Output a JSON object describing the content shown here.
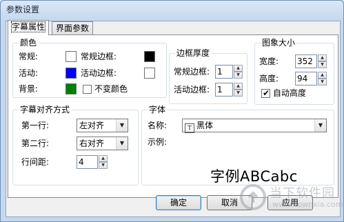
{
  "window": {
    "title": "参数设置"
  },
  "tabs": [
    {
      "label": "字幕属性",
      "active": true
    },
    {
      "label": "界面参数",
      "active": false
    }
  ],
  "colors_group": {
    "legend": "颜色",
    "normal_label": "常规:",
    "normal_color": "#ffffff",
    "normal_border_label": "常规边框:",
    "normal_border_color": "#000000",
    "active_label": "活动:",
    "active_color": "#0000ff",
    "active_border_label": "活动边框:",
    "active_border_color": "#ffffff",
    "background_label": "背景:",
    "background_color": "#008000",
    "fixed_color_label": "不变颜色",
    "fixed_color_checked": false
  },
  "border_thickness_group": {
    "legend": "边框厚度",
    "normal_label": "常规边框:",
    "normal_value": "1",
    "active_label": "活动边框:",
    "active_value": "1"
  },
  "image_size_group": {
    "legend": "图象大小",
    "width_label": "宽度:",
    "width_value": "352",
    "height_label": "高度:",
    "height_value": "94",
    "auto_height_label": "自动高度",
    "auto_height_checked": true
  },
  "alignment_group": {
    "legend": "字幕对齐方式",
    "line1_label": "第一行:",
    "line1_value": "左对齐",
    "line2_label": "第二行:",
    "line2_value": "右对齐",
    "line_spacing_label": "行间距:",
    "line_spacing_value": "4"
  },
  "font_group": {
    "legend": "字体",
    "name_label": "名称:",
    "name_value": "黑体",
    "sample_label": "示例:",
    "sample_text": "字例ABCabc"
  },
  "buttons": {
    "ok": "确定",
    "cancel": "取消",
    "apply": "应用"
  },
  "watermark": {
    "line1": "当下软件园",
    "line2": "www.downxia.com"
  }
}
